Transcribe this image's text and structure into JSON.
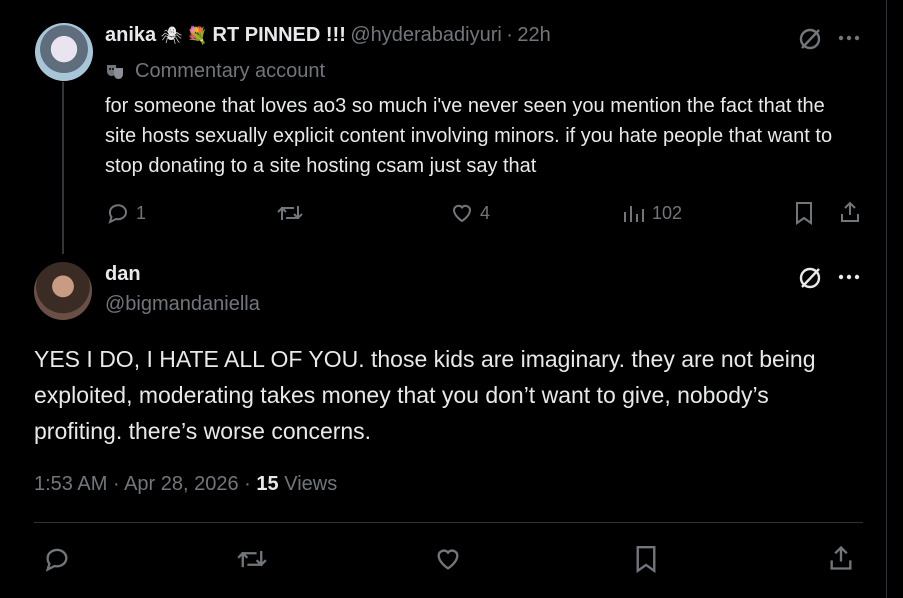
{
  "reply_tweet": {
    "display_name": "anika",
    "badges": "🕷 💐",
    "name_suffix": "RT PINNED !!!",
    "handle": "@hyderabadiyuri",
    "separator": "·",
    "time": "22h",
    "label": "Commentary account",
    "text": "for someone that loves ao3 so much i've never seen you mention the fact that the site hosts sexually explicit content involving minors. if you hate people that want to stop donating to a site hosting csam just say that",
    "reply_count": "1",
    "retweet_count": "",
    "like_count": "4",
    "view_count": "102"
  },
  "main_tweet": {
    "display_name": "dan",
    "handle": "@bigmandaniella",
    "text": "YES I DO, I HATE ALL OF YOU. those kids are imaginary. they are not being exploited, moderating takes money that you don’t want to give, nobody’s profiting. there’s worse concerns.",
    "time": "1:53 AM",
    "separator": "·",
    "date": "Apr 28, 2026",
    "views_count": "15",
    "views_label": "Views"
  },
  "colors": {
    "background": "#000000",
    "text": "#e7e9ea",
    "muted": "#71767b",
    "border": "#2f3336"
  }
}
